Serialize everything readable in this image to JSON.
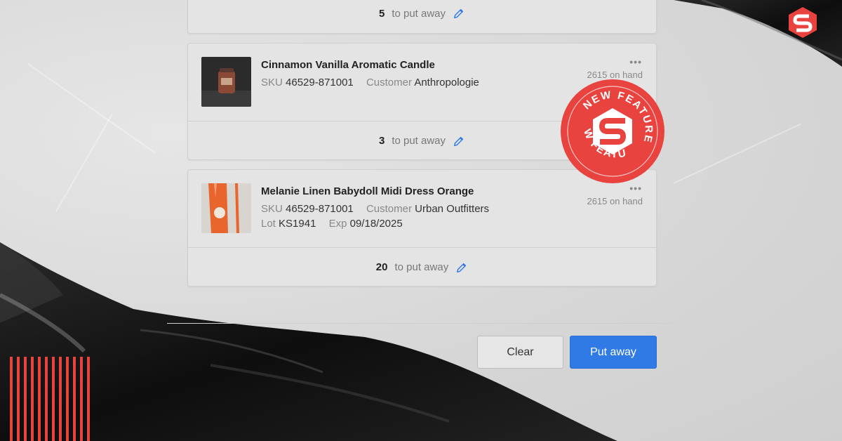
{
  "items": [
    {
      "qty": "5",
      "qty_label": "to put away"
    },
    {
      "title": "Cinnamon Vanilla Aromatic Candle",
      "sku_label": "SKU",
      "sku": "46529-871001",
      "customer_label": "Customer",
      "customer": "Anthropologie",
      "menu": "•••",
      "on_hand": "2615 on hand",
      "qty": "3",
      "qty_label": "to put away"
    },
    {
      "title": "Melanie Linen Babydoll Midi Dress Orange",
      "sku_label": "SKU",
      "sku": "46529-871001",
      "customer_label": "Customer",
      "customer": "Urban Outfitters",
      "lot_label": "Lot",
      "lot": "KS1941",
      "exp_label": "Exp",
      "exp": "09/18/2025",
      "menu": "•••",
      "on_hand": "2615 on hand",
      "qty": "20",
      "qty_label": "to put away"
    }
  ],
  "actions": {
    "clear": "Clear",
    "put_away": "Put away"
  },
  "badge": {
    "text": "NEW FEATURE",
    "color": "#e8433f"
  },
  "icons": {
    "edit": "pencil-icon",
    "menu": "more-icon",
    "logo": "shipbob-logo"
  },
  "colors": {
    "primary": "#2f7ae5",
    "accent": "#e8433f"
  }
}
